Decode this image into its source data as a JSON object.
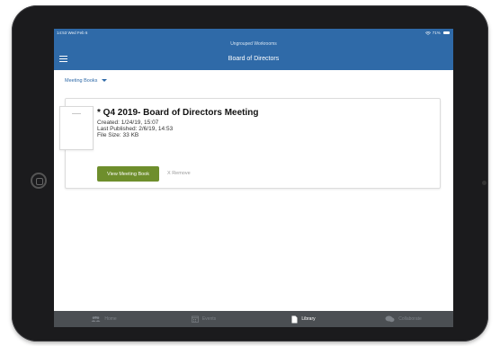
{
  "status_bar": {
    "time_date": "14:53  Wed Feb 6",
    "battery": "71%"
  },
  "header": {
    "workroom": "Ungrouped Workrooms",
    "title": "Board of Directors"
  },
  "filter": {
    "label": "Meeting Books"
  },
  "book": {
    "title": "* Q4 2019- Board of Directors Meeting",
    "created": "Created: 1/24/19, 15:07",
    "last_published": "Last Published: 2/6/19, 14:53",
    "file_size": "File Size: 33 KB",
    "view_button": "View Meeting Book",
    "remove_link": "X Remove"
  },
  "tabs": [
    {
      "label": "Home",
      "icon": "people-icon",
      "active": false
    },
    {
      "label": "Events",
      "icon": "calendar-icon",
      "active": false
    },
    {
      "label": "Library",
      "icon": "document-icon",
      "active": true
    },
    {
      "label": "Collaborate",
      "icon": "chat-icon",
      "active": false
    }
  ],
  "colors": {
    "header_bg": "#2f6aa8",
    "accent_green": "#6e8e2c",
    "tabbar_bg": "#4b4f53"
  }
}
